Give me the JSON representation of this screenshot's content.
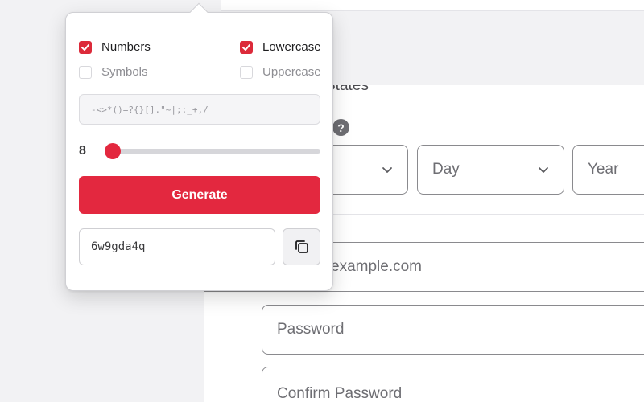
{
  "form": {
    "clipped_label": "States",
    "day_select": "Day",
    "year_select": "Year",
    "email_placeholder": "example.com",
    "password_placeholder": "Password",
    "confirm_placeholder": "Confirm Password",
    "help_glyph": "?"
  },
  "generator": {
    "options": {
      "numbers": {
        "label": "Numbers",
        "checked": true
      },
      "lowercase": {
        "label": "Lowercase",
        "checked": true
      },
      "symbols": {
        "label": "Symbols",
        "checked": false
      },
      "uppercase": {
        "label": "Uppercase",
        "checked": false
      }
    },
    "symbols_set": "-<>*()=?{}[].\"~|;:_+,/",
    "length": {
      "value": "8",
      "fraction": 0.0
    },
    "generate_label": "Generate",
    "generated_password": "6w9gda4q"
  },
  "colors": {
    "accent": "#e3283f",
    "checkbox": "#dc2a3a"
  },
  "icons": {
    "select_chevron": "chevron-down-icon",
    "copy": "copy-icon",
    "check": "checkmark-icon",
    "help": "question-icon"
  }
}
